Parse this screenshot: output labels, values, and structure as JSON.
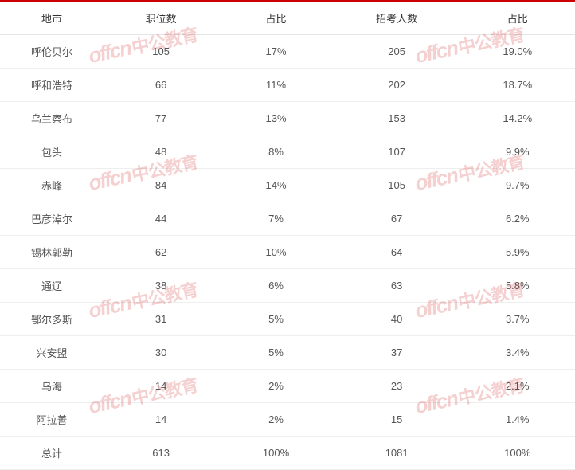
{
  "chart_data": {
    "type": "table",
    "headers": [
      "地市",
      "职位数",
      "占比",
      "招考人数",
      "占比"
    ],
    "rows": [
      {
        "city": "呼伦贝尔",
        "positions": 105,
        "pct1": "17%",
        "recruits": 205,
        "pct2": "19.0%"
      },
      {
        "city": "呼和浩特",
        "positions": 66,
        "pct1": "11%",
        "recruits": 202,
        "pct2": "18.7%"
      },
      {
        "city": "乌兰察布",
        "positions": 77,
        "pct1": "13%",
        "recruits": 153,
        "pct2": "14.2%"
      },
      {
        "city": "包头",
        "positions": 48,
        "pct1": "8%",
        "recruits": 107,
        "pct2": "9.9%"
      },
      {
        "city": "赤峰",
        "positions": 84,
        "pct1": "14%",
        "recruits": 105,
        "pct2": "9.7%"
      },
      {
        "city": "巴彦淖尔",
        "positions": 44,
        "pct1": "7%",
        "recruits": 67,
        "pct2": "6.2%"
      },
      {
        "city": "锡林郭勒",
        "positions": 62,
        "pct1": "10%",
        "recruits": 64,
        "pct2": "5.9%"
      },
      {
        "city": "通辽",
        "positions": 38,
        "pct1": "6%",
        "recruits": 63,
        "pct2": "5.8%"
      },
      {
        "city": "鄂尔多斯",
        "positions": 31,
        "pct1": "5%",
        "recruits": 40,
        "pct2": "3.7%"
      },
      {
        "city": "兴安盟",
        "positions": 30,
        "pct1": "5%",
        "recruits": 37,
        "pct2": "3.4%"
      },
      {
        "city": "乌海",
        "positions": 14,
        "pct1": "2%",
        "recruits": 23,
        "pct2": "2.1%"
      },
      {
        "city": "阿拉善",
        "positions": 14,
        "pct1": "2%",
        "recruits": 15,
        "pct2": "1.4%"
      },
      {
        "city": "总计",
        "positions": 613,
        "pct1": "100%",
        "recruits": 1081,
        "pct2": "100%"
      }
    ]
  },
  "watermark": {
    "en": "offcn",
    "cn": "中公教育"
  }
}
